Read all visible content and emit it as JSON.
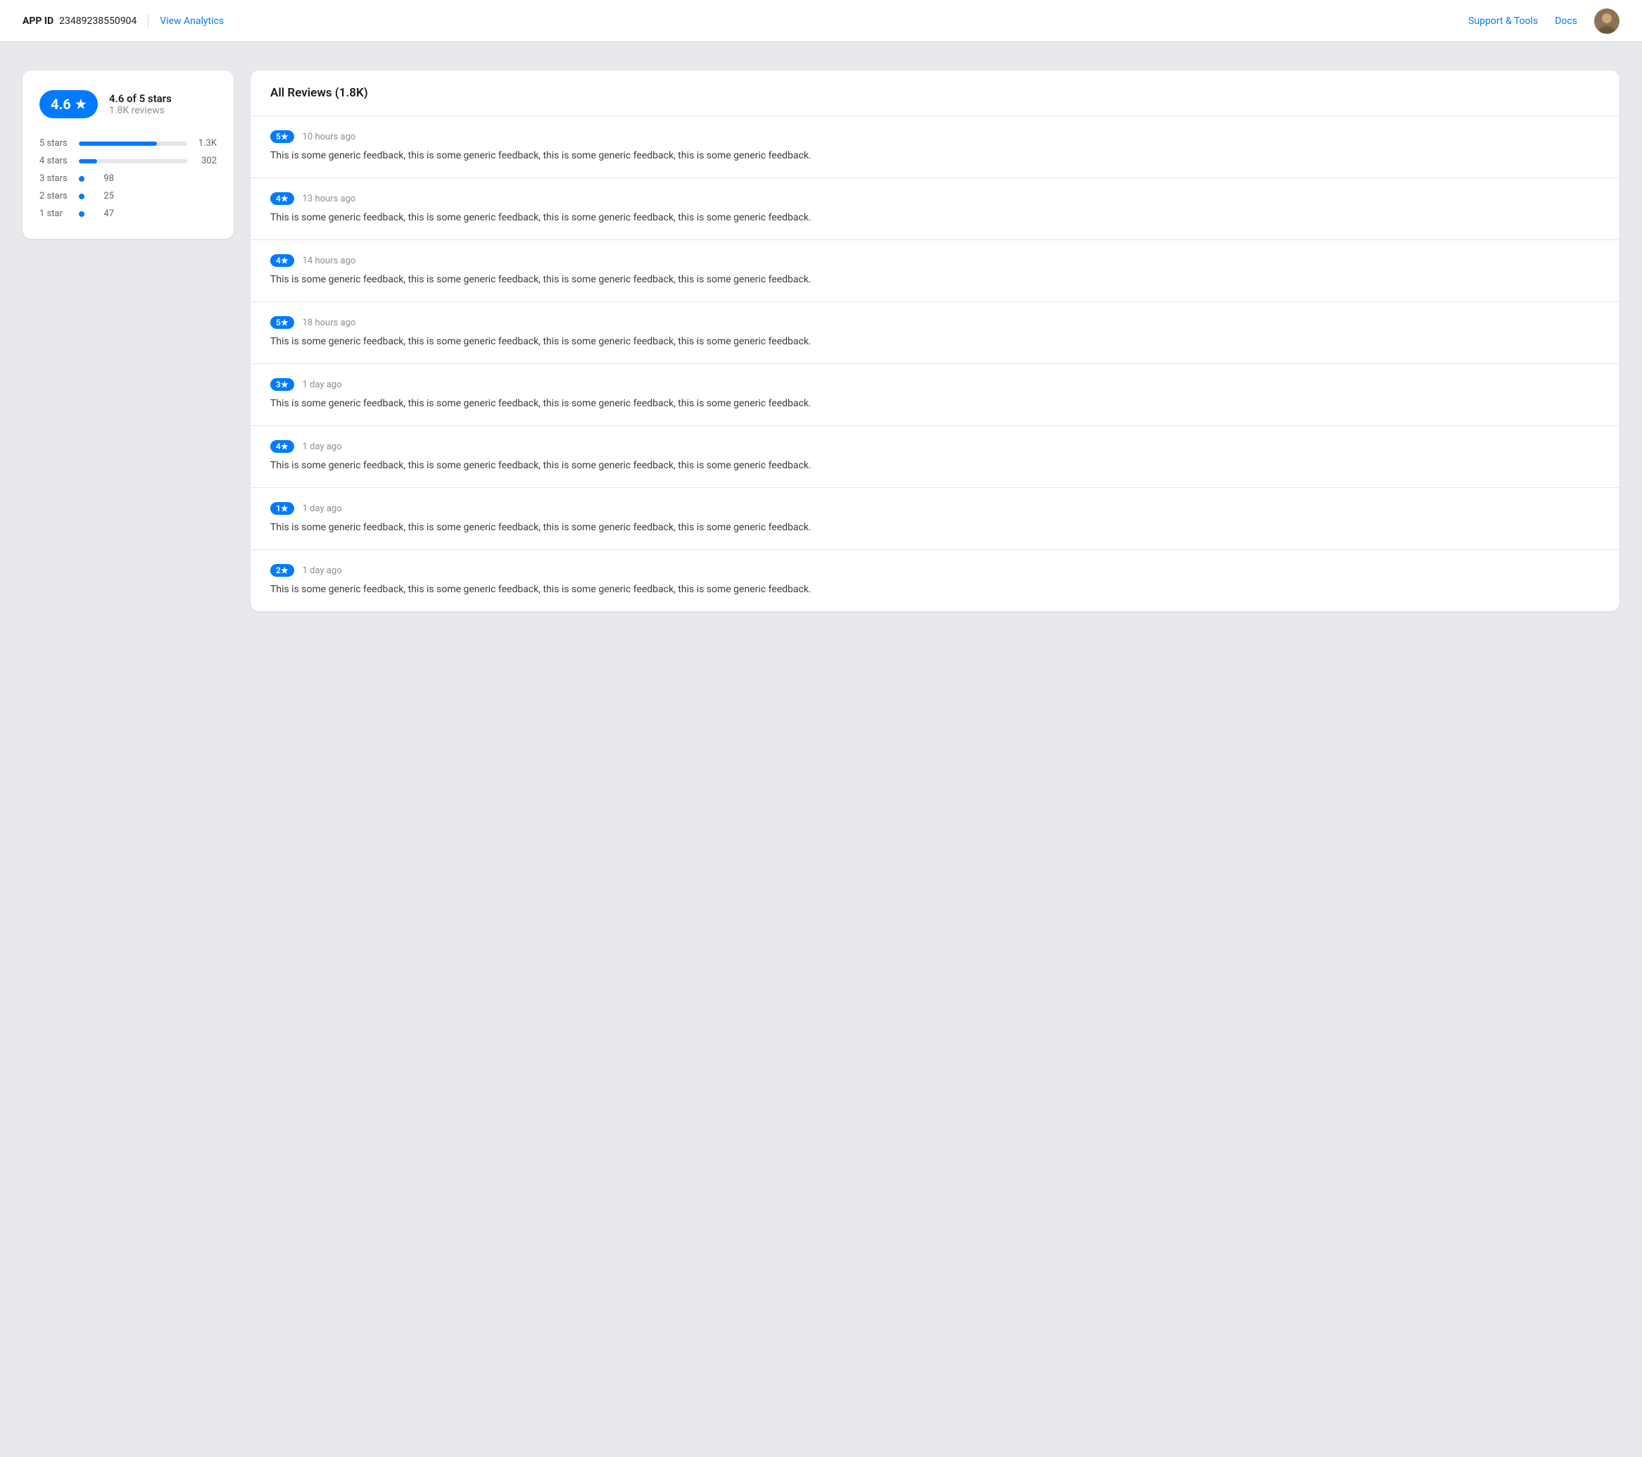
{
  "header": {
    "app_id_label": "APP ID",
    "app_id_value": "23489238550904",
    "view_analytics_label": "View Analytics",
    "support_tools_label": "Support & Tools",
    "docs_label": "Docs"
  },
  "rating_card": {
    "score": "4.6",
    "star_symbol": "★",
    "score_text": "4.6 of 5 stars",
    "reviews_count": "1.8K reviews",
    "bars": [
      {
        "label": "5 stars",
        "fill_pct": 72,
        "count": "1.3K",
        "show_bar": true
      },
      {
        "label": "4 stars",
        "fill_pct": 17,
        "count": "302",
        "show_bar": true
      },
      {
        "label": "3 stars",
        "fill_pct": 5,
        "count": "98",
        "show_bar": false
      },
      {
        "label": "2 stars",
        "fill_pct": 1,
        "count": "25",
        "show_bar": false
      },
      {
        "label": "1 star",
        "fill_pct": 3,
        "count": "47",
        "show_bar": false
      }
    ]
  },
  "reviews": {
    "heading": "All Reviews (1.8K)",
    "items": [
      {
        "stars": "5★",
        "time": "10 hours ago",
        "text": "This is some generic feedback, this is some generic feedback, this is some generic feedback, this is some generic feedback."
      },
      {
        "stars": "4★",
        "time": "13 hours ago",
        "text": "This is some generic feedback, this is some generic feedback, this is some generic feedback, this is some generic feedback."
      },
      {
        "stars": "4★",
        "time": "14 hours ago",
        "text": "This is some generic feedback, this is some generic feedback, this is some generic feedback, this is some generic feedback."
      },
      {
        "stars": "5★",
        "time": "18 hours ago",
        "text": "This is some generic feedback, this is some generic feedback, this is some generic feedback, this is some generic feedback."
      },
      {
        "stars": "3★",
        "time": "1 day ago",
        "text": "This is some generic feedback, this is some generic feedback, this is some generic feedback, this is some generic feedback."
      },
      {
        "stars": "4★",
        "time": "1 day ago",
        "text": "This is some generic feedback, this is some generic feedback, this is some generic feedback, this is some generic feedback."
      },
      {
        "stars": "1★",
        "time": "1 day ago",
        "text": "This is some generic feedback, this is some generic feedback, this is some generic feedback, this is some generic feedback."
      },
      {
        "stars": "2★",
        "time": "1 day ago",
        "text": "This is some generic feedback, this is some generic feedback, this is some generic feedback, this is some generic feedback."
      }
    ]
  }
}
